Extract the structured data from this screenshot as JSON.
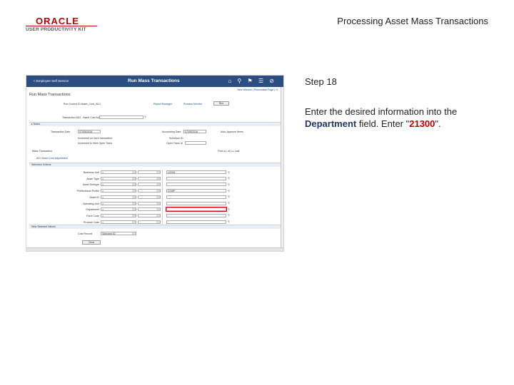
{
  "logo": {
    "brand": "ORACLE",
    "sub": "USER PRODUCTIVITY KIT"
  },
  "doc_title": "Processing Asset Mass Transactions",
  "step": {
    "label": "Step 18"
  },
  "instruction": {
    "prefix": "Enter the desired information into the ",
    "field": "Department",
    "middle": " field. Enter \"",
    "value": "21300",
    "suffix": "\"."
  },
  "screenshot": {
    "nav_back": "< Employee Self Service",
    "title": "Run Mass Transactions",
    "header_icons": "⌂ ⚲ ⚑ ☰ ⊘",
    "top_links": "New Window | Personalize Page | ⊡",
    "page_heading": "Run Mass Transactions",
    "run_control": "Run Control ID  Asset_Cost_ADJ",
    "report_manager": "Report Manager",
    "process_monitor": "Process Monitor",
    "run_button": "Run",
    "transaction": "Transaction  ADJ - Asset Cost Adjustment",
    "notes_band": "▸ Notes",
    "transaction_date_label": "Transaction Date",
    "transaction_date_value": "07/05/2016",
    "accounting_date_label": "Accounting Date",
    "accounting_date_value": "07/05/2016",
    "auto_approve": "Auto-Approve Items",
    "checkbox1": "Increment on each transaction",
    "checkbox2": "Increment to Next Open Trans",
    "schedule_id": "Schedule ID",
    "open_trans": "Open Trans Id",
    "mass_transaction": "Mass Transaction",
    "grid_nav": "First  ◂ 1 of 1 ▸  Last",
    "adj_link": "ADJ  Asset Cost Adjustment",
    "selection_band": "Selection Criteria",
    "criteria": [
      {
        "label": "Business Unit",
        "op": "=",
        "value": "US001"
      },
      {
        "label": "Asset Type",
        "op": "=",
        "value": ""
      },
      {
        "label": "Asset Subtype",
        "op": "=",
        "value": ""
      },
      {
        "label": "Profile/Asset Profile",
        "op": "=",
        "value": "COMP"
      },
      {
        "label": "Asset ID",
        "op": "=",
        "value": ""
      },
      {
        "label": "Operating Unit",
        "op": "=",
        "value": ""
      },
      {
        "label": "Department",
        "op": "=",
        "value": ""
      },
      {
        "label": "Fund Code",
        "op": "=",
        "value": ""
      },
      {
        "label": "Product Code",
        "op": "=",
        "value": ""
      }
    ],
    "new_values_band": "New Selected Values",
    "cost_record_label": "Cost Record",
    "cost_record_value": "Selected ID",
    "clear_button": "Clear"
  },
  "colors": {
    "header": "#2c4d80",
    "highlight": "#d00000",
    "field_text": "#1f3864"
  }
}
